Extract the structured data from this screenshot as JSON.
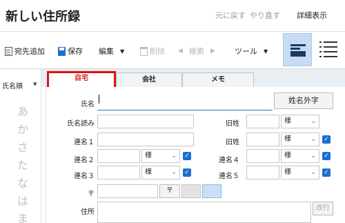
{
  "header": {
    "title": "新しい住所録",
    "undo_label": "元に戻す",
    "redo_label": "やり直す",
    "detail_label": "詳細表示"
  },
  "toolbar": {
    "add_label": "宛先追加",
    "save_label": "保存",
    "edit_label": "編集",
    "delete_label": "削除",
    "search_label": "検索",
    "tools_label": "ツール"
  },
  "sidebar": {
    "sort_label": "氏名順",
    "kana": [
      "あ",
      "か",
      "さ",
      "た",
      "な",
      "は",
      "ま"
    ]
  },
  "tabs": {
    "home": "自宅",
    "company": "会社",
    "memo": "メモ"
  },
  "form": {
    "name_label": "氏名",
    "name_value": "",
    "external_char_button": "姓名外字",
    "name_reading_label": "氏名読み",
    "old_surname_label": "旧姓",
    "joint_name1_label": "連名１",
    "joint_name2_label": "連名２",
    "joint_name3_label": "連名３",
    "joint_name4_label": "連名４",
    "joint_name5_label": "連名５",
    "honorific_value": "様",
    "postal_label": "〒",
    "postal_button": "〒",
    "address_label": "住所",
    "newline_button": "改行"
  },
  "colors": {
    "accent": "#1a6fd0",
    "active_tab_border": "#e01010",
    "active_view_bg": "#c7dcf4"
  },
  "icons": [
    "add-contact-icon",
    "save-icon",
    "trash-icon",
    "card-view-icon",
    "list-view-icon",
    "chevron-down-icon",
    "checkbox-checked-icon"
  ]
}
